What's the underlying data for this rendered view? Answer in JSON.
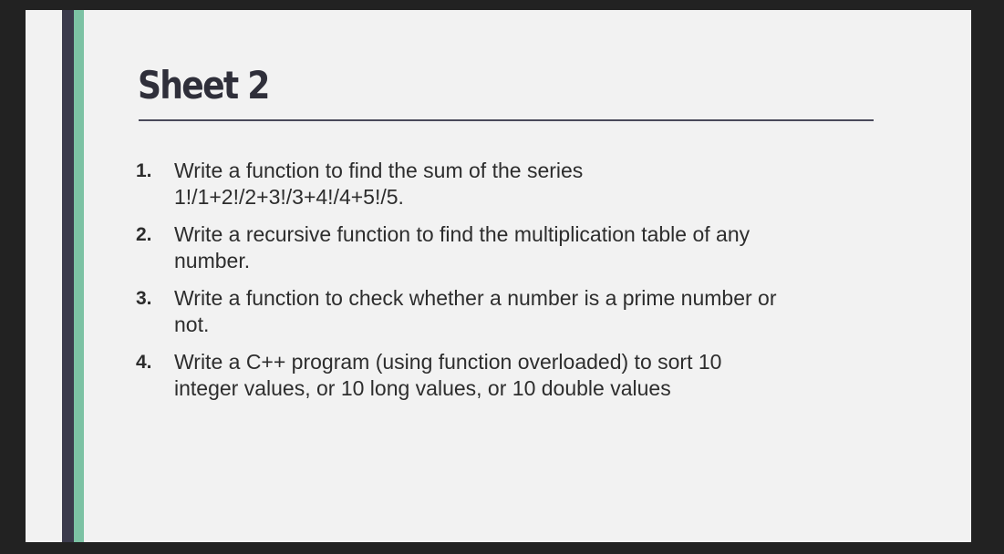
{
  "slide": {
    "title": "Sheet 2",
    "items": [
      {
        "number": "1.",
        "lines": [
          "Write a function to find the sum of the series",
          "1!/1+2!/2+3!/3+4!/4+5!/5."
        ]
      },
      {
        "number": "2.",
        "lines": [
          "Write a recursive function to find the multiplication table of any",
          "number."
        ]
      },
      {
        "number": "3.",
        "lines": [
          "Write a function to check whether a number is a prime number or",
          "not."
        ]
      },
      {
        "number": "4.",
        "lines": [
          "Write a C++ program (using function overloaded) to sort 10",
          "integer values, or 10 long values, or 10 double values"
        ]
      }
    ]
  },
  "colors": {
    "background": "#222222",
    "slide": "#f2f2f2",
    "accent_dark": "#3b3b4c",
    "accent_green": "#7cc2a4",
    "text": "#2d2d2d"
  }
}
